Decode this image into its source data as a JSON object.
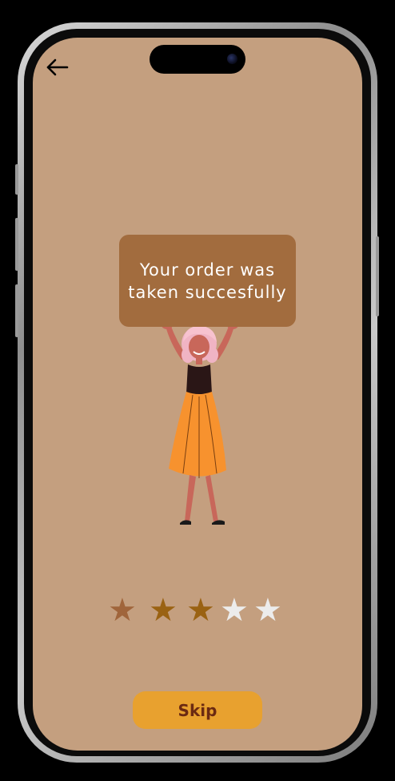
{
  "screen": {
    "background_color": "#c49f7f",
    "back_icon": "arrow-left-icon"
  },
  "toast": {
    "message": "Your order was taken succesfully",
    "background_color": "#a26c3e"
  },
  "illustration": {
    "subject": "woman-holding-sign-illustration"
  },
  "rating": {
    "value": 3,
    "max": 5,
    "star_glyph": "★",
    "star_colors": [
      "#a0653b",
      "#9a6212",
      "#9a6212",
      "#ececec",
      "#ececec"
    ]
  },
  "skip_button": {
    "label": "Skip",
    "background_color": "#e8a12f",
    "text_color": "#6b2a12"
  }
}
